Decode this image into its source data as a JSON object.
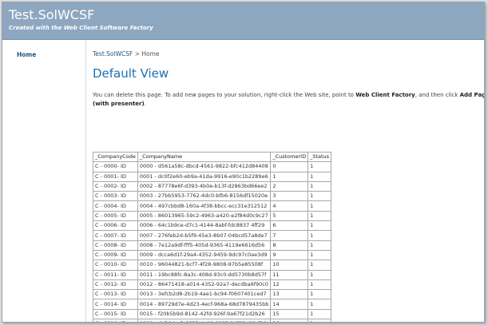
{
  "site": {
    "title": "Test.SolWCSF",
    "subtitle": "Created with the Web Client Software Factory"
  },
  "sidebar": {
    "items": [
      {
        "label": "Home"
      }
    ]
  },
  "breadcrumb": {
    "root": "Test.SolWCSF",
    "separator": " > ",
    "current": "Home"
  },
  "main": {
    "title": "Default View",
    "intro_part1": "You can delete this page. To add new pages to your solution, right-click the Web site, point to ",
    "intro_bold1": "Web Client Factory",
    "intro_part2": ", and then click ",
    "intro_bold2": "Add Page",
    "intro_bold3": "(with presenter)",
    "intro_end": "."
  },
  "table": {
    "columns": [
      "_CompanyCode",
      "_CompanyName",
      "_CustomerID",
      "_Status"
    ],
    "rows": [
      [
        "C - 0000- ID",
        "0000 - d561a58c-dbcd-4561-9822-bfc412d84408",
        "0",
        "1"
      ],
      [
        "C - 0001- ID",
        "0001 - dc0f2e60-eb9a-41da-9916-e90c1b2289e6",
        "1",
        "1"
      ],
      [
        "C - 0002- ID",
        "0002 - 87778e6f-d393-4b0e-b13f-d2863bd66ee2",
        "2",
        "1"
      ],
      [
        "C - 0003- ID",
        "0003 - 27bb5953-7762-4dc0-bfb6-8156df15020e",
        "3",
        "1"
      ],
      [
        "C - 0004- ID",
        "0004 - 497cbbd8-160a-4f38-bbcc-ecc31e312512",
        "4",
        "1"
      ],
      [
        "C - 0005- ID",
        "0005 - 86013965-59c2-4963-a420-e2f84d0c9c27",
        "5",
        "1"
      ],
      [
        "C - 0006- ID",
        "0006 - 64c1b9ce-d7c1-4144-8abf-fdc8837 4ff29",
        "6",
        "1"
      ],
      [
        "C - 0007- ID",
        "0007 - 276feb2d-b5f9-45e3-8b07-04bcd57a8de7",
        "7",
        "1"
      ],
      [
        "C - 0008- ID",
        "0008 - 7e12a9df-fff5-405d-9365-4119e6616d56",
        "8",
        "1"
      ],
      [
        "C - 0009- ID",
        "0009 - dcca6d1f-29a4-4352-9459-9dc97c0ae3d9",
        "9",
        "1"
      ],
      [
        "C - 0010- ID",
        "0010 - 96044821-bcf7-4f28-9808-97b5e85508f",
        "10",
        "1"
      ],
      [
        "C - 0011- ID",
        "0011 - 19bc88fc-8a3c-408d-93c0-dd5730b8d57f",
        "11",
        "1"
      ],
      [
        "C - 0012- ID",
        "0012 - 86471418-a014-4352-92a7-decdba6f90c0",
        "12",
        "1"
      ],
      [
        "C - 0013- ID",
        "0013 - 3efcb2d8-2b19-4ae1-bc94-f0607401ced7",
        "13",
        "1"
      ],
      [
        "C - 0014- ID",
        "0014 - 89729d7e-4d23-4ecf-968a-68d7879435bb",
        "14",
        "1"
      ],
      [
        "C - 0015- ID",
        "0015 - f20b5b9d-8142-42fd-926f-9a67f21d2b26",
        "15",
        "1"
      ],
      [
        "C - 0016- ID",
        "0016 - da56dcc5-6635-4e18-8863-14f23a66cf29",
        "16",
        "1"
      ],
      [
        "C - 0017- ID",
        "0017 - b8c8dcfe-26ce-4bd1-8758-0df7572c8531",
        "17",
        "1"
      ]
    ]
  }
}
